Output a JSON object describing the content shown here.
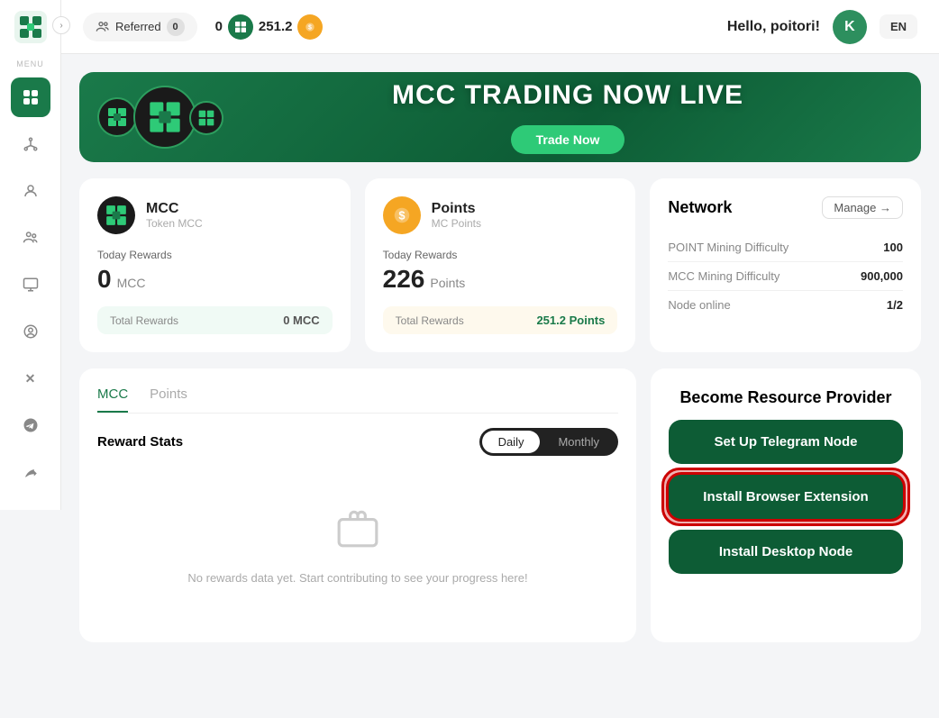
{
  "sidebar": {
    "menu_label": "MENU",
    "icons": [
      {
        "name": "grid-icon",
        "label": "Dashboard",
        "active": true
      },
      {
        "name": "network-icon",
        "label": "Network",
        "active": false
      },
      {
        "name": "user-circle-icon",
        "label": "Profile",
        "active": false
      },
      {
        "name": "users-icon",
        "label": "Referrals",
        "active": false
      },
      {
        "name": "monitor-icon",
        "label": "Monitor",
        "active": false
      },
      {
        "name": "person-icon",
        "label": "Account",
        "active": false
      }
    ],
    "bottom_icons": [
      {
        "name": "x-icon",
        "label": "X / Twitter"
      },
      {
        "name": "telegram-icon",
        "label": "Telegram"
      },
      {
        "name": "leaf-icon",
        "label": "Other"
      }
    ]
  },
  "topbar": {
    "referred_label": "Referred",
    "referred_count": "0",
    "points_value": "251.2",
    "hello_text": "Hello, poitori!",
    "avatar_letter": "K",
    "lang": "EN"
  },
  "banner": {
    "title": "MCC TRADING NOW LIVE",
    "trade_button": "Trade Now"
  },
  "mcc_card": {
    "title": "MCC",
    "subtitle": "Token MCC",
    "today_rewards_label": "Today Rewards",
    "today_amount": "0",
    "today_unit": "MCC",
    "total_label": "Total Rewards",
    "total_value": "0 MCC"
  },
  "points_card": {
    "title": "Points",
    "subtitle": "MC Points",
    "today_rewards_label": "Today Rewards",
    "today_amount": "226",
    "today_unit": "Points",
    "total_label": "Total Rewards",
    "total_value": "251.2 Points"
  },
  "network_card": {
    "title": "Network",
    "manage_label": "Manage →",
    "rows": [
      {
        "label": "POINT Mining Difficulty",
        "value": "100"
      },
      {
        "label": "MCC Mining Difficulty",
        "value": "900,000"
      },
      {
        "label": "Node online",
        "value": "1/2"
      }
    ]
  },
  "rewards_section": {
    "tabs": [
      {
        "label": "MCC",
        "active": true
      },
      {
        "label": "Points",
        "active": false
      }
    ],
    "stats_label": "Reward Stats",
    "toggle": {
      "daily": "Daily",
      "monthly": "Monthly",
      "active": "daily"
    },
    "empty_text": "No rewards data yet. Start contributing to see your progress here!"
  },
  "resource_card": {
    "title": "Become Resource Provider",
    "buttons": [
      {
        "label": "Set Up Telegram Node",
        "highlighted": false
      },
      {
        "label": "Install Browser Extension",
        "highlighted": true
      },
      {
        "label": "Install Desktop Node",
        "highlighted": false
      }
    ]
  }
}
